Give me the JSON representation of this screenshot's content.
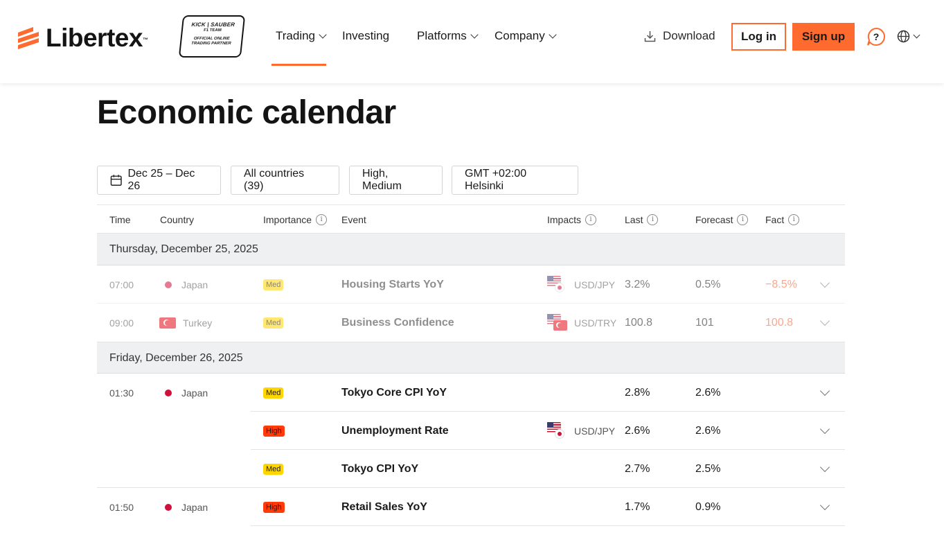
{
  "brand": {
    "name": "Libertex",
    "tm": "™",
    "accent": "#ff6a2f",
    "partner": {
      "line1": "KICK | SAUBER",
      "line2": "F1 TEAM",
      "line3": "OFFICIAL ONLINE",
      "line4": "TRADING PARTNER"
    }
  },
  "nav": {
    "items": [
      {
        "label": "Trading",
        "has_dropdown": true,
        "active": true
      },
      {
        "label": "Investing",
        "has_dropdown": false
      },
      {
        "label": "Platforms",
        "has_dropdown": true
      },
      {
        "label": "Company",
        "has_dropdown": true
      }
    ]
  },
  "header": {
    "download": "Download",
    "login": "Log in",
    "signup": "Sign up",
    "help_icon": "question-icon",
    "language_icon": "globe-icon"
  },
  "page": {
    "title": "Economic calendar"
  },
  "filters": {
    "dates": "Dec 25 – Dec 26",
    "countries": "All countries (39)",
    "importance": "High, Medium",
    "timezone": "GMT +02:00 Helsinki"
  },
  "table": {
    "columns": {
      "time": "Time",
      "country": "Country",
      "importance": "Importance",
      "event": "Event",
      "impacts": "Impacts",
      "last": "Last",
      "forecast": "Forecast",
      "fact": "Fact"
    },
    "days": [
      {
        "label": "Thursday, December 25, 2025"
      },
      {
        "label": "Friday, December 26, 2025"
      }
    ],
    "rows": [
      {
        "time": "07:00",
        "country": "Japan",
        "importance": "Med",
        "event": "Housing Starts YoY",
        "impact": "USD/JPY",
        "last": "3.2%",
        "forecast": "0.5%",
        "fact": "−8.5%"
      },
      {
        "time": "09:00",
        "country": "Turkey",
        "importance": "Med",
        "event": "Business Confidence",
        "impact": "USD/TRY",
        "last": "100.8",
        "forecast": "101",
        "fact": "100.8"
      },
      {
        "time": "01:30",
        "country": "Japan",
        "importance": "Med",
        "event": "Tokyo Core CPI YoY",
        "impact": "",
        "last": "2.8%",
        "forecast": "2.6%",
        "fact": ""
      },
      {
        "time": "",
        "country": "",
        "importance": "High",
        "event": "Unemployment Rate",
        "impact": "USD/JPY",
        "last": "2.6%",
        "forecast": "2.6%",
        "fact": ""
      },
      {
        "time": "",
        "country": "",
        "importance": "Med",
        "event": "Tokyo CPI YoY",
        "impact": "",
        "last": "2.7%",
        "forecast": "2.5%",
        "fact": ""
      },
      {
        "time": "01:50",
        "country": "Japan",
        "importance": "High",
        "event": "Retail Sales YoY",
        "impact": "",
        "last": "1.7%",
        "forecast": "0.9%",
        "fact": ""
      }
    ]
  }
}
